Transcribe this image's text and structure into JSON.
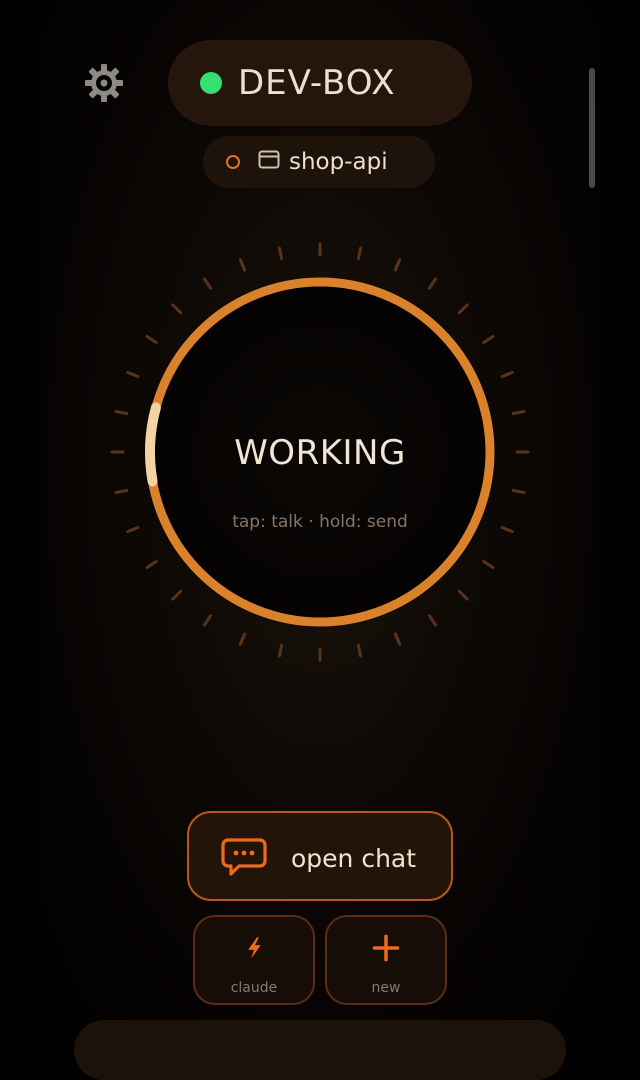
{
  "header": {
    "host_name": "DEV-BOX",
    "host_status": "online",
    "project_name": "shop-api"
  },
  "dial": {
    "state_label": "WORKING",
    "hint": "tap: talk · hold: send",
    "progress_fraction": 0.07
  },
  "actions": {
    "open_chat_label": "open chat",
    "claude_label": "claude",
    "new_label": "new"
  },
  "colors": {
    "accent": "#d9822b",
    "accent_highlight": "#f3d2a4",
    "status_online": "#33e070",
    "button_border": "#b8561c",
    "icon_orange": "#ef6a1f"
  },
  "icons": {
    "settings": "gear-icon",
    "window": "window-icon",
    "chat": "chat-bubble-icon",
    "claude": "lightning-icon",
    "new": "plus-icon"
  }
}
